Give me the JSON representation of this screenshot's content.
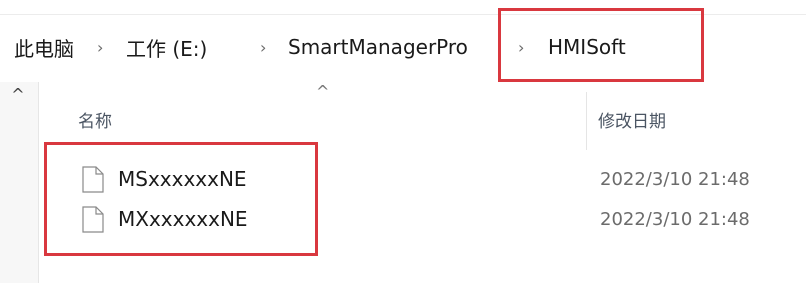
{
  "breadcrumb": {
    "items": [
      "此电脑",
      "工作 (E:)",
      "SmartManagerPro",
      "HMISoft"
    ],
    "separator": "›"
  },
  "columns": {
    "name": "名称",
    "modified": "修改日期"
  },
  "files": [
    {
      "name": "MSxxxxxxNE",
      "modified": "2022/3/10 21:48"
    },
    {
      "name": "MXxxxxxxNE",
      "modified": "2022/3/10 21:48"
    }
  ],
  "icons": {
    "scroll_up": "^",
    "sort": "^",
    "file": "file-icon"
  },
  "colors": {
    "highlight": "#d9383f"
  }
}
